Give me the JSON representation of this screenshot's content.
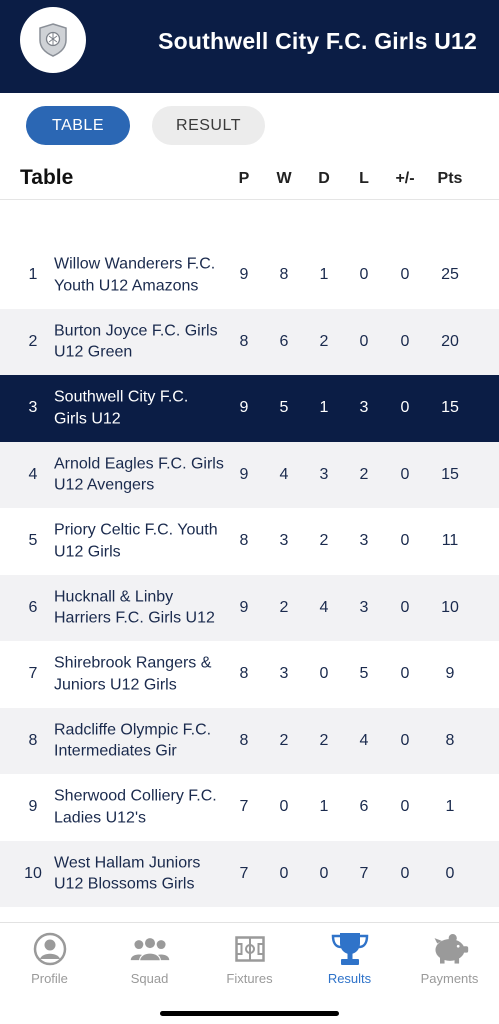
{
  "header": {
    "title": "Southwell City F.C. Girls U12",
    "logo_icon": "club-crest-icon"
  },
  "tabs": [
    {
      "label": "TABLE",
      "active": true
    },
    {
      "label": "RESULT",
      "active": false
    }
  ],
  "table": {
    "title": "Table",
    "columns": {
      "p": "P",
      "w": "W",
      "d": "D",
      "l": "L",
      "gd": "+/-",
      "pts": "Pts"
    },
    "rows": [
      {
        "pos": "1",
        "team": "Willow Wanderers F.C. Youth U12 Amazons",
        "p": "9",
        "w": "8",
        "d": "1",
        "l": "0",
        "gd": "0",
        "pts": "25"
      },
      {
        "pos": "2",
        "team": "Burton Joyce F.C. Girls U12 Green",
        "p": "8",
        "w": "6",
        "d": "2",
        "l": "0",
        "gd": "0",
        "pts": "20"
      },
      {
        "pos": "3",
        "team": "Southwell City F.C. Girls U12",
        "p": "9",
        "w": "5",
        "d": "1",
        "l": "3",
        "gd": "0",
        "pts": "15",
        "highlight": true
      },
      {
        "pos": "4",
        "team": "Arnold Eagles F.C. Girls U12 Avengers",
        "p": "9",
        "w": "4",
        "d": "3",
        "l": "2",
        "gd": "0",
        "pts": "15"
      },
      {
        "pos": "5",
        "team": "Priory Celtic F.C. Youth U12 Girls",
        "p": "8",
        "w": "3",
        "d": "2",
        "l": "3",
        "gd": "0",
        "pts": "11"
      },
      {
        "pos": "6",
        "team": "Hucknall & Linby Harriers F.C. Girls U12",
        "p": "9",
        "w": "2",
        "d": "4",
        "l": "3",
        "gd": "0",
        "pts": "10"
      },
      {
        "pos": "7",
        "team": "Shirebrook Rangers & Juniors U12 Girls",
        "p": "8",
        "w": "3",
        "d": "0",
        "l": "5",
        "gd": "0",
        "pts": "9"
      },
      {
        "pos": "8",
        "team": "Radcliffe Olympic F.C. Intermediates Gir",
        "p": "8",
        "w": "2",
        "d": "2",
        "l": "4",
        "gd": "0",
        "pts": "8"
      },
      {
        "pos": "9",
        "team": "Sherwood Colliery F.C. Ladies U12's",
        "p": "7",
        "w": "0",
        "d": "1",
        "l": "6",
        "gd": "0",
        "pts": "1"
      },
      {
        "pos": "10",
        "team": "West Hallam Juniors U12 Blossoms Girls",
        "p": "7",
        "w": "0",
        "d": "0",
        "l": "7",
        "gd": "0",
        "pts": "0"
      }
    ]
  },
  "bottom_nav": [
    {
      "label": "Profile",
      "icon": "profile-icon",
      "active": false
    },
    {
      "label": "Squad",
      "icon": "squad-icon",
      "active": false
    },
    {
      "label": "Fixtures",
      "icon": "fixtures-icon",
      "active": false
    },
    {
      "label": "Results",
      "icon": "trophy-icon",
      "active": true
    },
    {
      "label": "Payments",
      "icon": "piggy-bank-icon",
      "active": false
    }
  ],
  "colors": {
    "navy": "#0b1d45",
    "accent_blue": "#2b67b4",
    "active_nav": "#2f73c9",
    "row_alt": "#f2f2f4"
  }
}
